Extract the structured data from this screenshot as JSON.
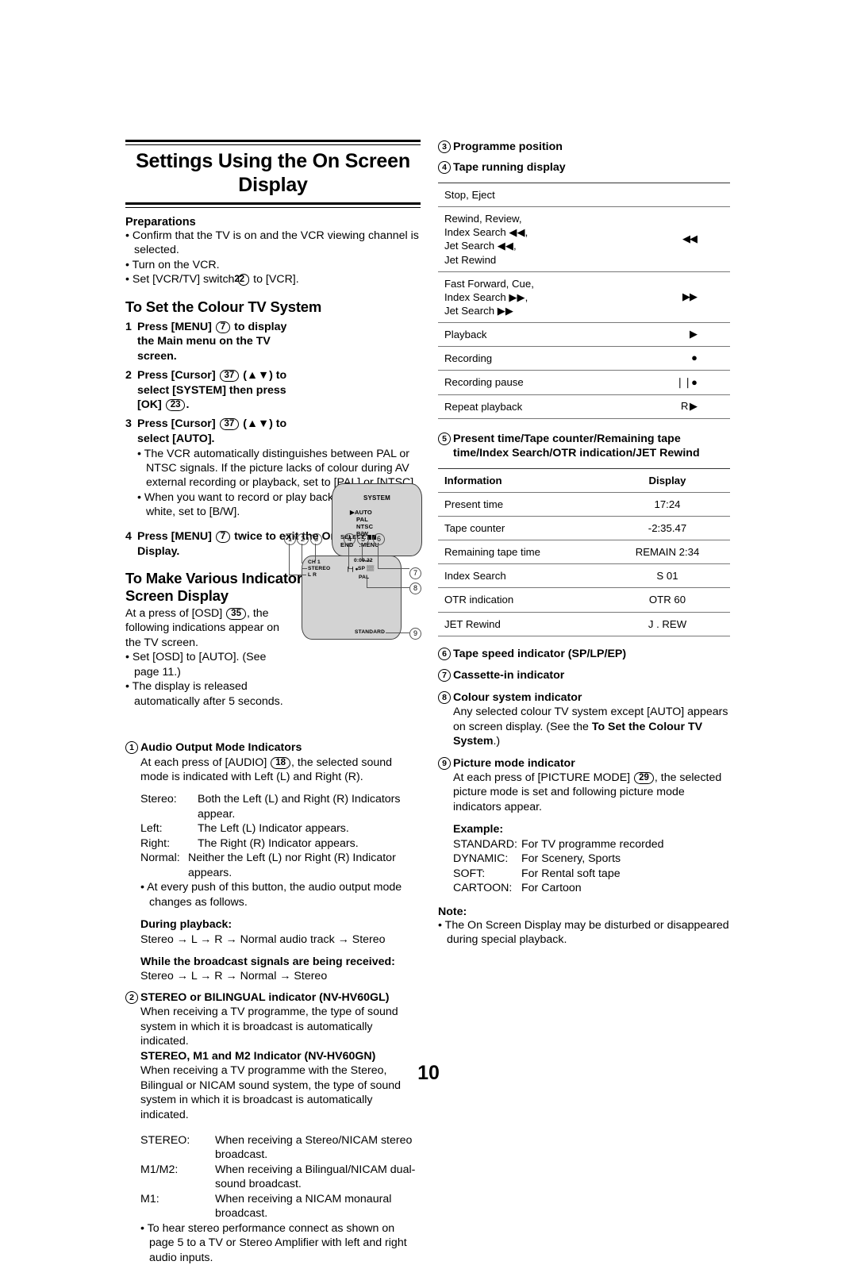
{
  "page_number": "10",
  "title": "Settings Using the On Screen Display",
  "preparations": {
    "heading": "Preparations",
    "items": [
      "Confirm that the TV is on and the VCR viewing channel is selected.",
      "Turn on the VCR.",
      "Set [VCR/TV] switch"
    ],
    "vcrtv_pill": "22",
    "vcrtv_tail": "to [VCR]."
  },
  "colour_system": {
    "heading": "To Set the Colour TV System",
    "step1": {
      "num": "1",
      "a": "Press [MENU]",
      "pill": "7",
      "b": "to display the Main menu on the TV screen."
    },
    "step2": {
      "num": "2",
      "a": "Press [Cursor]",
      "pill": "37",
      "b": "(▲▼) to select [SYSTEM] then press [OK]",
      "pill2": "23",
      "c": "."
    },
    "step3": {
      "num": "3",
      "a": "Press [Cursor]",
      "pill": "37",
      "b": "(▲▼) to select [AUTO]."
    },
    "bullets": [
      "The VCR automatically distinguishes between PAL or NTSC signals. If the picture lacks of colour during AV external recording or playback, set to [PAL] or [NTSC].",
      "When you want to record or play back in black and white, set to [B/W]."
    ],
    "step4": {
      "num": "4",
      "a": "Press [MENU]",
      "pill": "7",
      "b": "twice to exit the On Screen Display."
    },
    "menu_screen": {
      "title": "SYSTEM",
      "options": [
        "AUTO",
        "PAL",
        "NTSC",
        "B/W"
      ],
      "selected": "AUTO",
      "select_label": "SELECT:",
      "end_label": "END",
      "end_value": ":MENU"
    }
  },
  "indicators": {
    "heading": "To Make Various Indicators Appear On Screen Display",
    "intro_a": "At a press of [OSD]",
    "intro_pill": "35",
    "intro_b": ", the following indications appear on the TV screen.",
    "bullets": [
      "Set [OSD] to [AUTO]. (See page 11.)",
      "The display is released automatically after 5 seconds."
    ],
    "osd_screen": {
      "callouts_top": [
        "1",
        "2",
        "3",
        "4",
        "5",
        "6"
      ],
      "callouts_right": [
        "7",
        "8",
        "9"
      ],
      "channel": "CH 1",
      "stereo": "STEREO",
      "lr": "L R",
      "counter": "0:09.22",
      "speed": "SP",
      "pausing": "❘❘●",
      "colour_system": "PAL",
      "picture_mode": "STANDARD"
    }
  },
  "item1": {
    "num": "1",
    "heading": "Audio Output Mode Indicators",
    "p1_a": "At each press of [AUDIO]",
    "p1_pill": "18",
    "p1_b": ", the selected sound mode is indicated with Left (L) and Right (R).",
    "modes": [
      {
        "k": "Stereo:",
        "v": "Both the Left (L) and Right (R) Indicators appear."
      },
      {
        "k": "Left:",
        "v": "The Left (L) Indicator appears."
      },
      {
        "k": "Right:",
        "v": "The Right (R) Indicator appears."
      },
      {
        "k": "Normal:",
        "v": "Neither the Left (L) nor Right (R) Indicator appears."
      }
    ],
    "bullet": "At every push of this button, the audio output mode changes as follows.",
    "playback_heading": "During playback:",
    "playback_seq": "Stereo → L → R → Normal audio track → Stereo",
    "broadcast_heading": "While the broadcast signals are being received:",
    "broadcast_seq": "Stereo → L → R → Normal → Stereo"
  },
  "item2": {
    "num": "2",
    "heading": "STEREO or BILINGUAL indicator (NV-HV60GL)",
    "p1": "When receiving a TV programme, the type of sound system in which it is broadcast is automatically indicated.",
    "heading2": "STEREO, M1 and M2 Indicator (NV-HV60GN)",
    "p2": "When receiving a TV programme with the Stereo, Bilingual or NICAM sound system, the type of sound system in which it is broadcast is automatically indicated.",
    "defs": [
      {
        "k": "STEREO:",
        "v": "When receiving a Stereo/NICAM stereo broadcast."
      },
      {
        "k": "M1/M2:",
        "v": "When receiving a Bilingual/NICAM dual-sound broadcast."
      },
      {
        "k": "M1:",
        "v": "When receiving a NICAM monaural broadcast."
      }
    ],
    "bullet": "To hear stereo performance connect as shown on page 5 to a TV or Stereo Amplifier with left and right audio inputs."
  },
  "item3": {
    "num": "3",
    "heading": "Programme position"
  },
  "item4": {
    "num": "4",
    "heading": "Tape running display",
    "rows": [
      {
        "info": [
          "Stop, Eject"
        ],
        "display": ""
      },
      {
        "info": [
          "Rewind, Review,",
          "Index Search ◀◀,",
          "Jet Search ◀◀,",
          "Jet Rewind"
        ],
        "display": "◀◀"
      },
      {
        "info": [
          "Fast Forward, Cue,",
          "Index Search ▶▶,",
          "Jet Search ▶▶"
        ],
        "display": "▶▶"
      },
      {
        "info": [
          "Playback"
        ],
        "display": "▶"
      },
      {
        "info": [
          "Recording"
        ],
        "display": "●"
      },
      {
        "info": [
          "Recording pause"
        ],
        "display": "❘❘●"
      },
      {
        "info": [
          "Repeat playback"
        ],
        "display": "R ▶"
      }
    ]
  },
  "item5": {
    "num": "5",
    "heading": "Present time/Tape counter/Remaining tape time/Index Search/OTR indication/JET Rewind",
    "columns": [
      "Information",
      "Display"
    ],
    "rows": [
      {
        "info": "Present time",
        "display": "17:24"
      },
      {
        "info": "Tape counter",
        "display": "-2:35.47"
      },
      {
        "info": "Remaining tape time",
        "display": "REMAIN 2:34"
      },
      {
        "info": "Index Search",
        "display": "S 01"
      },
      {
        "info": "OTR indication",
        "display": "OTR 60"
      },
      {
        "info": "JET Rewind",
        "display": "J . REW"
      }
    ]
  },
  "item6": {
    "num": "6",
    "heading": "Tape speed indicator (SP/LP/EP)"
  },
  "item7": {
    "num": "7",
    "heading": "Cassette-in indicator"
  },
  "item8": {
    "num": "8",
    "heading": "Colour system indicator",
    "p_a": "Any selected colour TV system except [AUTO] appears on screen display. (See the ",
    "p_bold": "To Set the Colour TV System",
    "p_b": ".)"
  },
  "item9": {
    "num": "9",
    "heading": "Picture mode indicator",
    "p_a": "At each press of [PICTURE MODE]",
    "p_pill": "29",
    "p_b": ", the selected picture mode is set and following picture mode indicators appear.",
    "example_heading": "Example:",
    "examples": [
      {
        "k": "STANDARD:",
        "v": "For TV programme recorded"
      },
      {
        "k": "DYNAMIC:",
        "v": "For Scenery, Sports"
      },
      {
        "k": "SOFT:",
        "v": "For Rental soft tape"
      },
      {
        "k": "CARTOON:",
        "v": "For Cartoon"
      }
    ]
  },
  "note": {
    "heading": "Note:",
    "text": "The On Screen Display may be disturbed or disappeared during special playback."
  }
}
